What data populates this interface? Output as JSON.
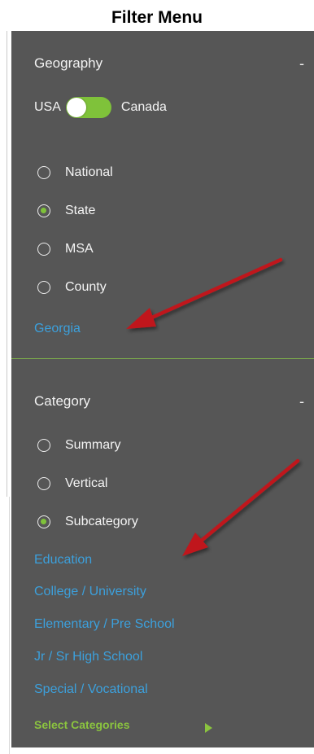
{
  "page": {
    "title": "Filter Menu"
  },
  "geography": {
    "title": "Geography",
    "collapse_label": "-",
    "toggle": {
      "left_label": "USA",
      "right_label": "Canada"
    },
    "options": [
      {
        "label": "National",
        "checked": false
      },
      {
        "label": "State",
        "checked": true
      },
      {
        "label": "MSA",
        "checked": false
      },
      {
        "label": "County",
        "checked": false
      }
    ],
    "selected_value": "Georgia"
  },
  "category": {
    "title": "Category",
    "collapse_label": "-",
    "options": [
      {
        "label": "Summary",
        "checked": false
      },
      {
        "label": "Vertical",
        "checked": false
      },
      {
        "label": "Subcategory",
        "checked": true
      }
    ],
    "subcategories": [
      "Education",
      "College / University",
      "Elementary / Pre School",
      "Jr / Sr High School",
      "Special / Vocational"
    ],
    "select_label": "Select Categories"
  },
  "colors": {
    "panel_bg": "#565656",
    "accent_green": "#7fc23a",
    "link_blue": "#3ca0dc",
    "arrow_red": "#c0191c"
  }
}
